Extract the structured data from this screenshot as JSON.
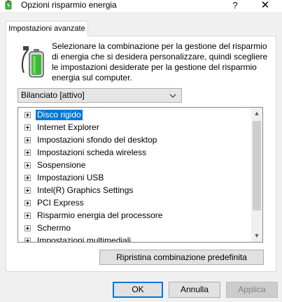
{
  "window": {
    "title": "Opzioni risparmio energia",
    "help_label": "?",
    "close_label": "✕"
  },
  "tab": {
    "label": "Impostazioni avanzate"
  },
  "description": "Selezionare la combinazione per la gestione del risparmio di energia che si desidera personalizzare, quindi scegliere le impostazioni desiderate per la gestione del risparmio energia sul computer.",
  "plan_select": {
    "value": "Bilanciato [attivo]"
  },
  "tree": {
    "items": [
      {
        "label": "Disco rigido",
        "selected": true
      },
      {
        "label": "Internet Explorer"
      },
      {
        "label": "Impostazioni sfondo del desktop"
      },
      {
        "label": "Impostazioni scheda wireless"
      },
      {
        "label": "Sospensione"
      },
      {
        "label": "Impostazioni USB"
      },
      {
        "label": "Intel(R) Graphics Settings"
      },
      {
        "label": "PCI Express"
      },
      {
        "label": "Risparmio energia del processore"
      },
      {
        "label": "Schermo"
      },
      {
        "label": "Impostazioni multimediali"
      }
    ]
  },
  "buttons": {
    "restore": "Ripristina combinazione predefinita",
    "ok": "OK",
    "cancel": "Annulla",
    "apply": "Applica"
  },
  "colors": {
    "selection": "#0078d7",
    "battery_green": "#3fb83a"
  },
  "icons": {
    "app": "power-options-icon",
    "battery": "battery-plug-icon",
    "dropdown": "chevron-down-icon",
    "expander": "plus-box-icon"
  }
}
